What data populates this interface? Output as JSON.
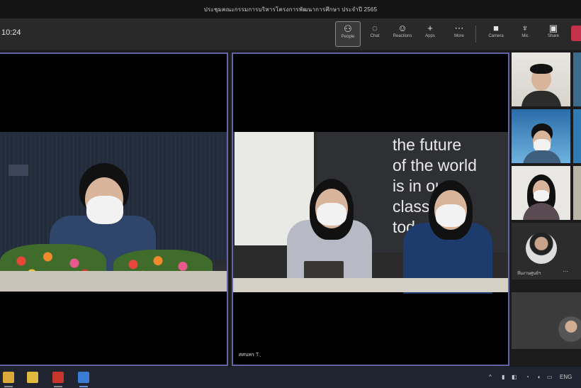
{
  "window": {
    "title": "ประชุมคณะกรรมการบริหารโครงการพัฒนาการศึกษา ประจำปี 2565"
  },
  "toolbar": {
    "timer": "10:24",
    "buttons": [
      {
        "label": "People",
        "icon": "people-icon",
        "active": true
      },
      {
        "label": "Chat",
        "icon": "chat-icon"
      },
      {
        "label": "Reactions",
        "icon": "reactions-icon"
      },
      {
        "label": "Apps",
        "icon": "plus-icon"
      },
      {
        "label": "More",
        "icon": "more-icon"
      },
      {
        "label": "Camera",
        "icon": "camera-icon"
      },
      {
        "label": "Mic",
        "icon": "mic-icon"
      },
      {
        "label": "Share",
        "icon": "share-icon"
      }
    ]
  },
  "videos": {
    "right_name": "ศศนพร T. ฺ",
    "slogan": "the future\nof the world\nis in our\nclassroom\ntoday"
  },
  "side": {
    "avatar_name": "ทีมงานศูนย์ฯ",
    "avatar_more": "⋯"
  },
  "taskbar": {
    "lang": "ENG"
  },
  "colors": {
    "accent": "#6264a7",
    "leave": "#c4314b"
  }
}
